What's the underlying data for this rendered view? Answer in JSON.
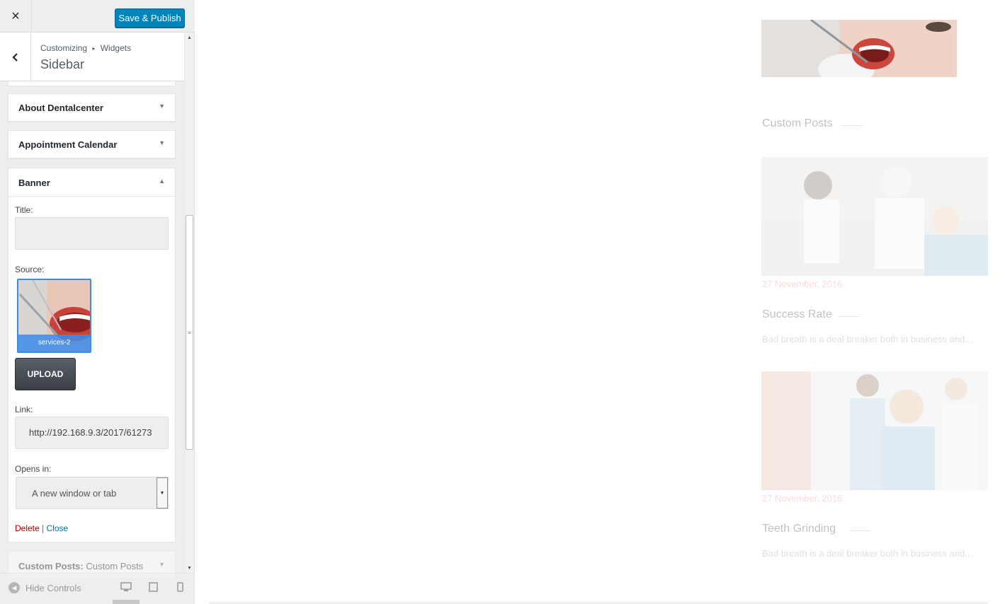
{
  "header": {
    "close_icon": "×",
    "publish_label": "Save & Publish",
    "publish_color": "#0085ba"
  },
  "section": {
    "back_icon": "‹",
    "breadcrumb_root": "Customizing",
    "breadcrumb_sep": "▸",
    "breadcrumb_child": "Widgets",
    "title": "Sidebar"
  },
  "widgets": {
    "about": {
      "title": "About Dentalcenter",
      "arrow": "▼"
    },
    "appointment": {
      "title": "Appointment Calendar",
      "arrow": "▼"
    },
    "banner": {
      "title": "Banner",
      "arrow": "▲",
      "title_label": "Title:",
      "title_value": "",
      "source_label": "Source:",
      "source_name": "services-2",
      "upload_label": "UPLOAD",
      "link_label": "Link:",
      "link_value": "http://192.168.9.3/2017/61273",
      "opens_label": "Opens in:",
      "opens_value": "A new window or tab",
      "delete_label": "Delete",
      "separator": "|",
      "close_label": "Close"
    },
    "custom_posts": {
      "title_prefix": "Custom Posts:",
      "title_suffix": "Custom Posts",
      "arrow": "▼"
    }
  },
  "footer": {
    "collapse_label": "Hide Controls",
    "devices": [
      "desktop-icon",
      "tablet-icon",
      "mobile-icon"
    ]
  },
  "preview": {
    "section_heading": "Custom Posts",
    "posts": [
      {
        "date": "27 November, 2016",
        "title": "Success Rate",
        "excerpt": "Bad breath is a deal breaker both in business and..."
      },
      {
        "date": "27 November, 2016",
        "title": "Teeth Grinding",
        "excerpt": "Bad breath is a deal breaker both in business and..."
      }
    ]
  },
  "scrollbar": {
    "grip": "≡",
    "up": "▲",
    "down": "▼"
  }
}
